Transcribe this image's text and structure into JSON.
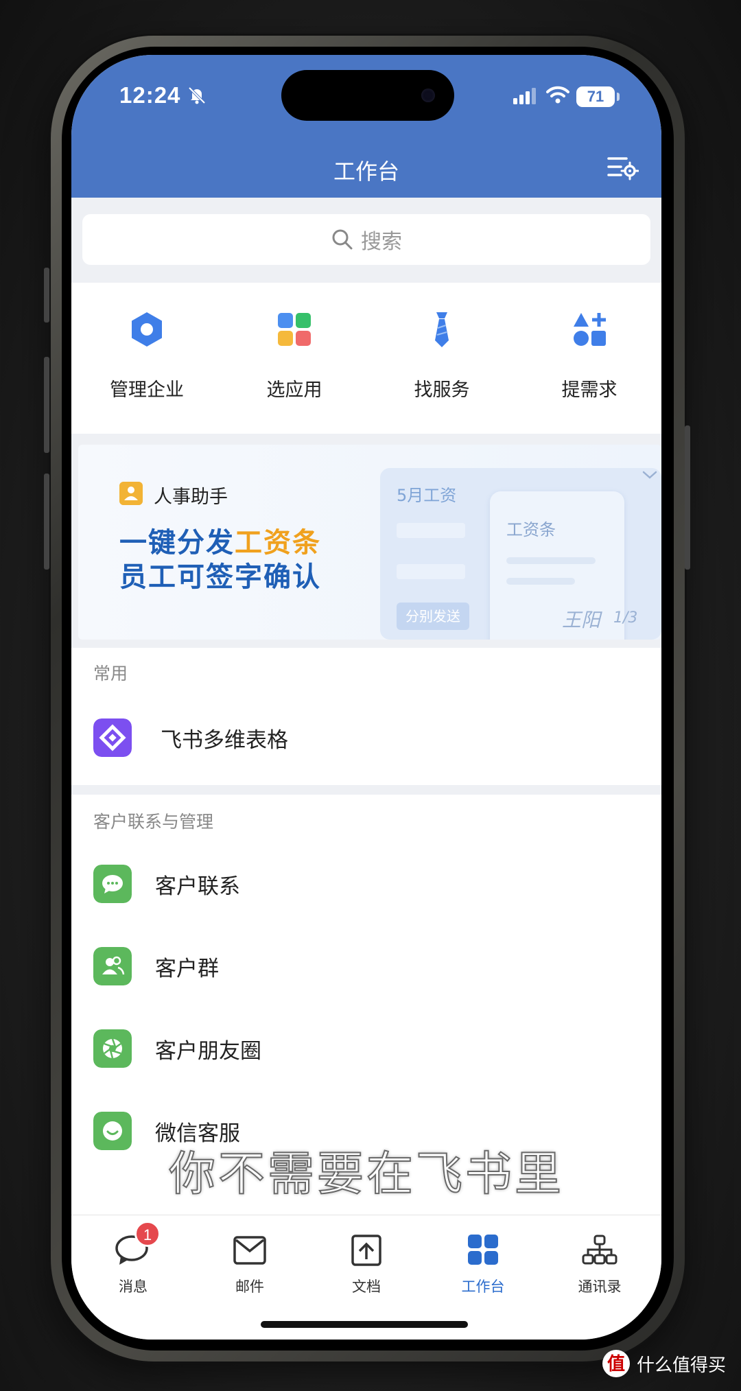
{
  "status_bar": {
    "time": "12:24",
    "battery": "71"
  },
  "header": {
    "title": "工作台"
  },
  "search": {
    "placeholder": "搜索"
  },
  "quick_actions": [
    {
      "label": "管理企业",
      "icon": "hexagon-icon"
    },
    {
      "label": "选应用",
      "icon": "app-grid-icon"
    },
    {
      "label": "找服务",
      "icon": "tie-icon"
    },
    {
      "label": "提需求",
      "icon": "shapes-plus-icon"
    }
  ],
  "banner": {
    "subtitle": "人事助手",
    "line1_prefix": "一键分发",
    "line1_highlight": "工资条",
    "line2": "员工可签字确认",
    "art_title": "5月工资",
    "art_card_title": "工资条",
    "art_send": "分别发送",
    "art_sign": "王阳",
    "page_indicator": "1/3"
  },
  "sections": {
    "common": {
      "title": "常用",
      "apps": [
        {
          "label": "飞书多维表格",
          "icon": "bitable-icon"
        }
      ]
    },
    "customer": {
      "title": "客户联系与管理",
      "apps": [
        {
          "label": "客户联系",
          "icon": "chat-bubble-icon"
        },
        {
          "label": "客户群",
          "icon": "group-icon"
        },
        {
          "label": "客户朋友圈",
          "icon": "aperture-icon"
        },
        {
          "label": "微信客服",
          "icon": "service-icon"
        }
      ]
    }
  },
  "tabbar": [
    {
      "label": "消息",
      "icon": "message-icon",
      "badge": "1"
    },
    {
      "label": "邮件",
      "icon": "mail-icon"
    },
    {
      "label": "文档",
      "icon": "doc-icon"
    },
    {
      "label": "工作台",
      "icon": "workbench-icon"
    },
    {
      "label": "通讯录",
      "icon": "contacts-icon"
    }
  ],
  "overlay": {
    "subtitle": "你不需要在飞书里",
    "watermark": "什么值得买"
  },
  "colors": {
    "header_blue": "#4a76c4",
    "accent_blue": "#2b6ccd",
    "highlight_orange": "#f0a11e",
    "wechat_green": "#5cb85c",
    "badge_red": "#e5484d"
  }
}
